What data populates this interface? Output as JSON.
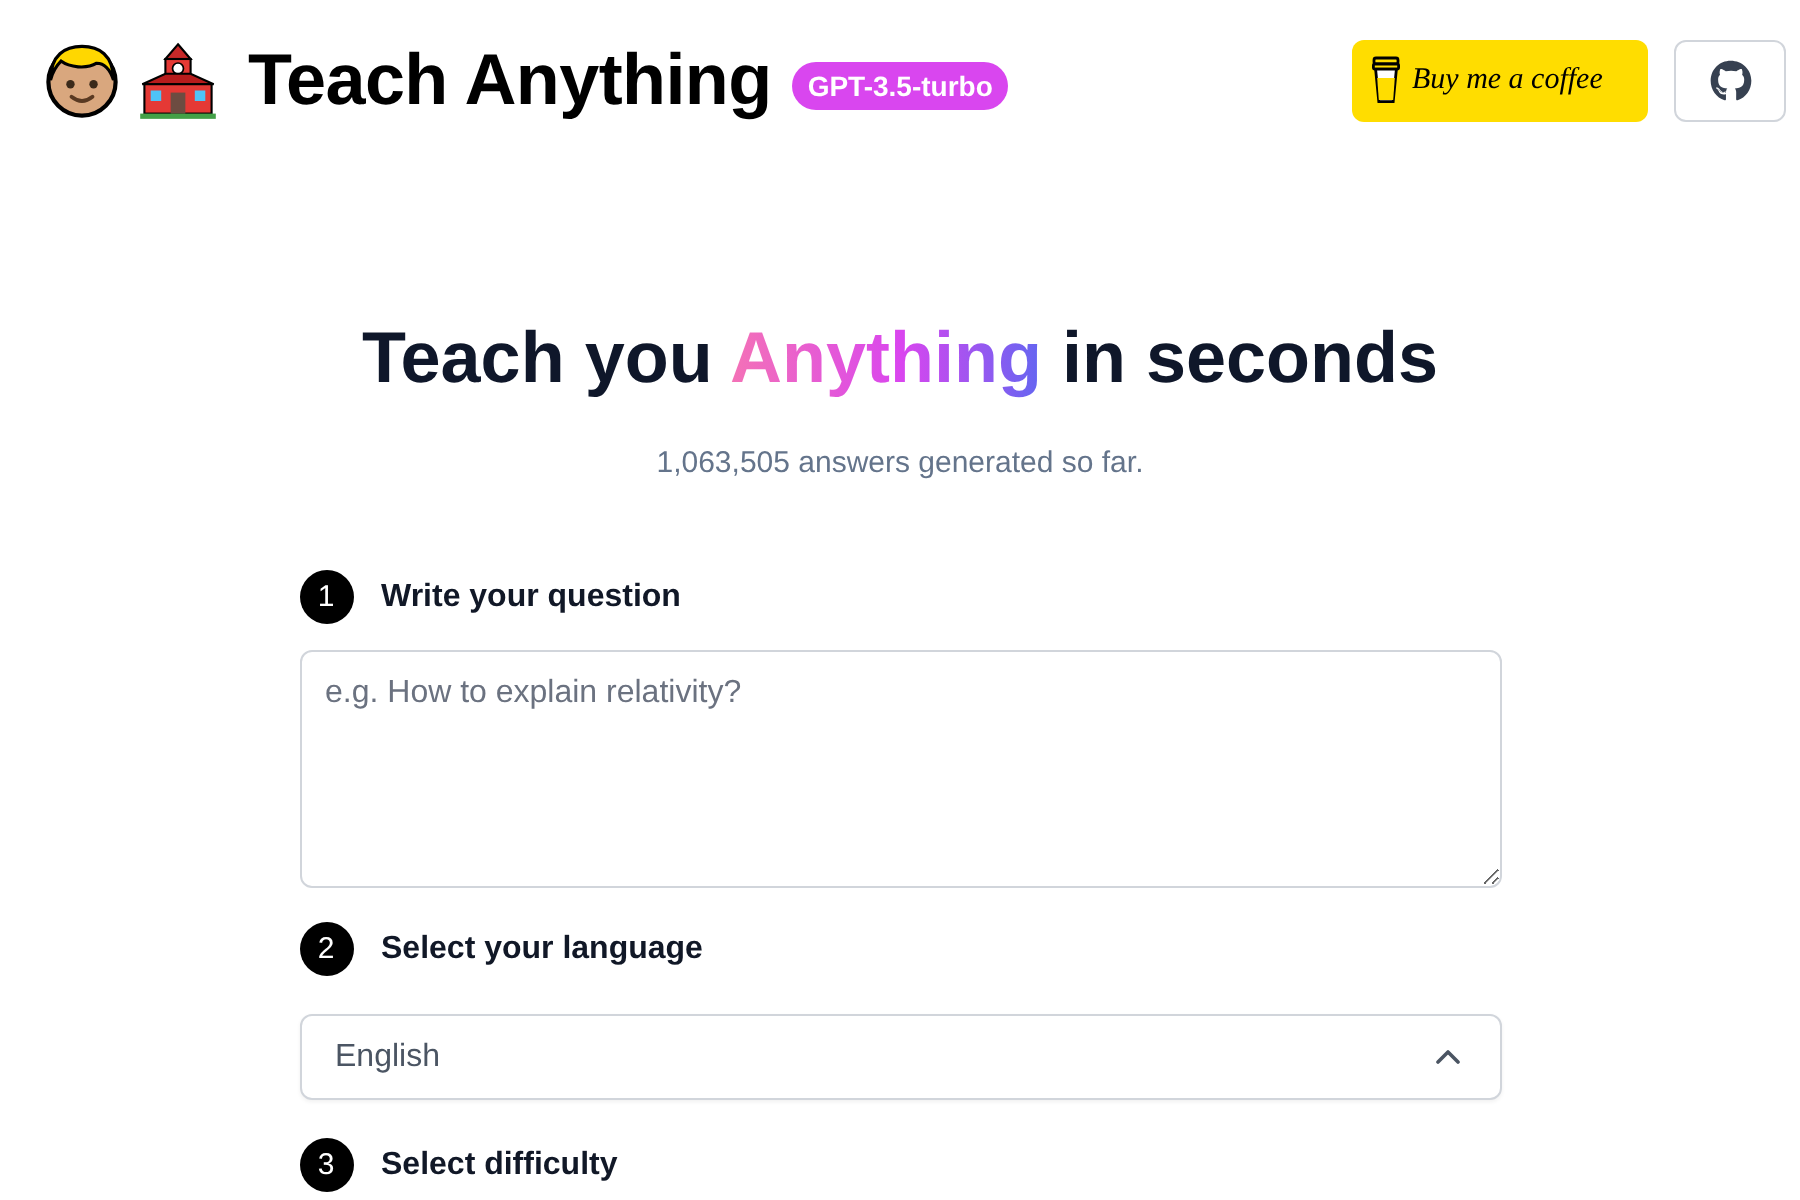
{
  "header": {
    "title": "Teach Anything",
    "badge": "GPT-3.5-turbo",
    "coffee_button": "Buy me a coffee"
  },
  "hero": {
    "heading_start": "Teach you",
    "heading_highlight": "Anything",
    "heading_end": "in seconds",
    "subtitle": "1,063,505 answers generated so far."
  },
  "steps": [
    {
      "number": "1",
      "label": "Write your question",
      "field": {
        "kind": "textarea",
        "placeholder": "e.g. How to explain relativity?"
      }
    },
    {
      "number": "2",
      "label": "Select your language",
      "field": {
        "kind": "select",
        "value": "English"
      }
    },
    {
      "number": "3",
      "label": "Select difficulty"
    }
  ]
}
